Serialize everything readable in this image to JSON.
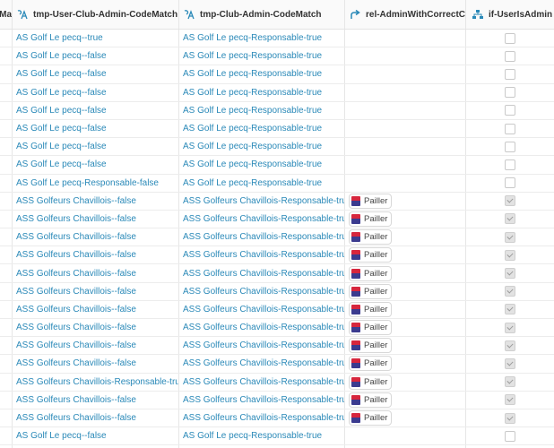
{
  "columns": [
    {
      "label": "eMa",
      "icon": ""
    },
    {
      "label": "tmp-User-Club-Admin-CodeMatch",
      "icon": "formula-text-icon"
    },
    {
      "label": "tmp-Club-Admin-CodeMatch",
      "icon": "formula-text-icon"
    },
    {
      "label": "rel-AdminWithCorrectCode",
      "icon": "relation-arrow-icon"
    },
    {
      "label": "if-UserIsAdmin",
      "icon": "formula-hierarchy-icon"
    }
  ],
  "rows": [
    {
      "user": "AS  Golf Le pecq--true",
      "club": "AS  Golf Le pecq-Responsable-true",
      "rel": "",
      "admin": false
    },
    {
      "user": "AS Golf Le pecq--false",
      "club": "AS Golf Le pecq-Responsable-true",
      "rel": "",
      "admin": false
    },
    {
      "user": "AS Golf Le pecq--false",
      "club": "AS Golf Le pecq-Responsable-true",
      "rel": "",
      "admin": false
    },
    {
      "user": "AS Golf Le pecq--false",
      "club": "AS Golf Le pecq-Responsable-true",
      "rel": "",
      "admin": false
    },
    {
      "user": "AS Golf Le pecq--false",
      "club": "AS Golf Le pecq-Responsable-true",
      "rel": "",
      "admin": false
    },
    {
      "user": "AS Golf Le pecq--false",
      "club": "AS Golf Le pecq-Responsable-true",
      "rel": "",
      "admin": false
    },
    {
      "user": "AS Golf Le pecq--false",
      "club": "AS Golf Le pecq-Responsable-true",
      "rel": "",
      "admin": false
    },
    {
      "user": "AS Golf Le pecq--false",
      "club": "AS Golf Le pecq-Responsable-true",
      "rel": "",
      "admin": false
    },
    {
      "user": "AS Golf Le pecq-Responsable-false",
      "club": "AS Golf Le pecq-Responsable-true",
      "rel": "",
      "admin": false
    },
    {
      "user": "ASS Golfeurs Chavillois--false",
      "club": "ASS Golfeurs Chavillois-Responsable-true",
      "rel": "Pailler",
      "admin": true
    },
    {
      "user": "ASS Golfeurs Chavillois--false",
      "club": "ASS Golfeurs Chavillois-Responsable-true",
      "rel": "Pailler",
      "admin": true
    },
    {
      "user": "ASS Golfeurs Chavillois--false",
      "club": "ASS Golfeurs Chavillois-Responsable-true",
      "rel": "Pailler",
      "admin": true
    },
    {
      "user": "ASS Golfeurs Chavillois--false",
      "club": "ASS Golfeurs Chavillois-Responsable-true",
      "rel": "Pailler",
      "admin": true
    },
    {
      "user": "ASS Golfeurs Chavillois--false",
      "club": "ASS Golfeurs Chavillois-Responsable-true",
      "rel": "Pailler",
      "admin": true
    },
    {
      "user": "ASS Golfeurs Chavillois--false",
      "club": "ASS Golfeurs Chavillois-Responsable-true",
      "rel": "Pailler",
      "admin": true
    },
    {
      "user": "ASS Golfeurs Chavillois--false",
      "club": "ASS Golfeurs Chavillois-Responsable-true",
      "rel": "Pailler",
      "admin": true
    },
    {
      "user": "ASS Golfeurs Chavillois--false",
      "club": "ASS Golfeurs Chavillois-Responsable-true",
      "rel": "Pailler",
      "admin": true
    },
    {
      "user": "ASS Golfeurs Chavillois--false",
      "club": "ASS Golfeurs Chavillois-Responsable-true",
      "rel": "Pailler",
      "admin": true
    },
    {
      "user": "ASS Golfeurs Chavillois--false",
      "club": "ASS Golfeurs Chavillois-Responsable-true",
      "rel": "Pailler",
      "admin": true
    },
    {
      "user": "ASS Golfeurs Chavillois-Responsable-true",
      "club": "ASS Golfeurs Chavillois-Responsable-true",
      "rel": "Pailler",
      "admin": true
    },
    {
      "user": "ASS Golfeurs Chavillois--false",
      "club": "ASS Golfeurs Chavillois-Responsable-true",
      "rel": "Pailler",
      "admin": true
    },
    {
      "user": "ASS Golfeurs Chavillois--false",
      "club": "ASS Golfeurs Chavillois-Responsable-true",
      "rel": "Pailler",
      "admin": true
    },
    {
      "user": "AS Golf Le pecq--false",
      "club": "AS Golf Le pecq-Responsable-true",
      "rel": "",
      "admin": false
    },
    {
      "user": "",
      "club": "",
      "rel": "",
      "admin": false
    }
  ],
  "colors": {
    "link": "#2a89b8",
    "icon": "#2a89b8"
  }
}
